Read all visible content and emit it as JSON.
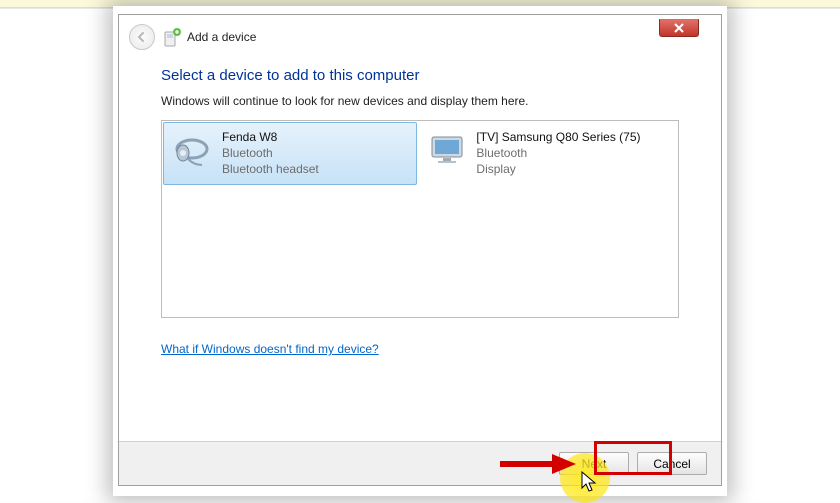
{
  "header": {
    "title": "Add a device"
  },
  "main": {
    "heading": "Select a device to add to this computer",
    "subtext": "Windows will continue to look for new devices and display them here.",
    "help_link": "What if Windows doesn't find my device?"
  },
  "devices": [
    {
      "name": "Fenda W8",
      "type": "Bluetooth",
      "category": "Bluetooth headset",
      "selected": true
    },
    {
      "name": "[TV] Samsung Q80 Series (75)",
      "type": "Bluetooth",
      "category": "Display",
      "selected": false
    }
  ],
  "footer": {
    "next": "Next",
    "cancel": "Cancel"
  }
}
